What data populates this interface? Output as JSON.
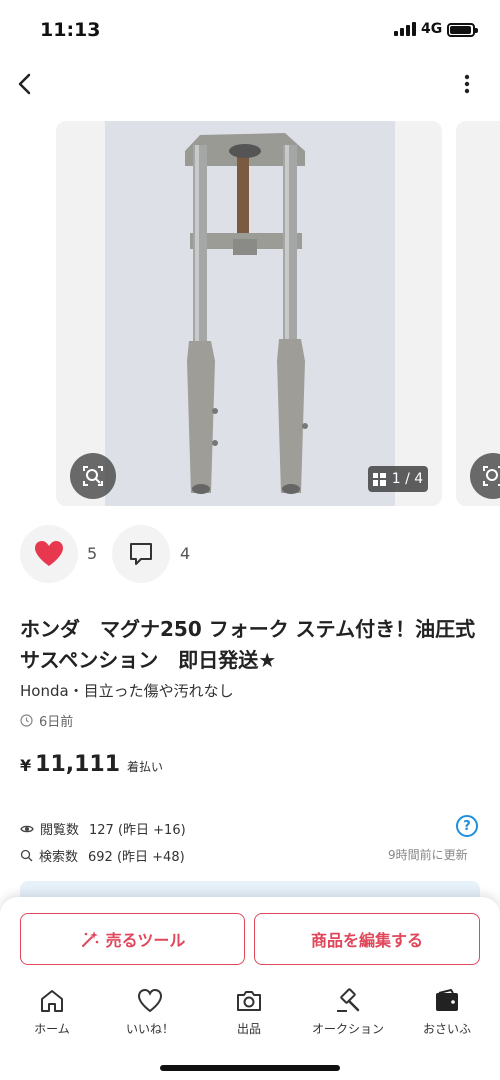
{
  "status_bar": {
    "time": "11:13",
    "network": "4G"
  },
  "gallery": {
    "counter": "1 / 4"
  },
  "actions": {
    "likes": "5",
    "comments": "4"
  },
  "item": {
    "title": "ホンダ　マグナ250 フォーク ステム付き！油圧式サスペンション　即日発送★",
    "subtitle": "Honda・目立った傷や汚れなし",
    "posted": "6日前",
    "price_symbol": "¥",
    "price": "11,111",
    "shipping": "着払い"
  },
  "stats": {
    "views_label": "閲覧数",
    "views_value": "127 (昨日 +16)",
    "search_label": "検索数",
    "search_value": "692 (昨日 +48)",
    "help": "?",
    "updated": "9時間前に更新"
  },
  "buttons": {
    "sell_tool": "売るツール",
    "edit_item": "商品を編集する"
  },
  "tabs": [
    {
      "label": "ホーム",
      "icon": "home-icon"
    },
    {
      "label": "いいね！",
      "icon": "heart-icon"
    },
    {
      "label": "出品",
      "icon": "camera-icon"
    },
    {
      "label": "オークション",
      "icon": "gavel-icon"
    },
    {
      "label": "おさいふ",
      "icon": "wallet-icon"
    }
  ],
  "colors": {
    "accent": "#e0475a",
    "like": "#e8384f",
    "info": "#1e8fe0"
  }
}
